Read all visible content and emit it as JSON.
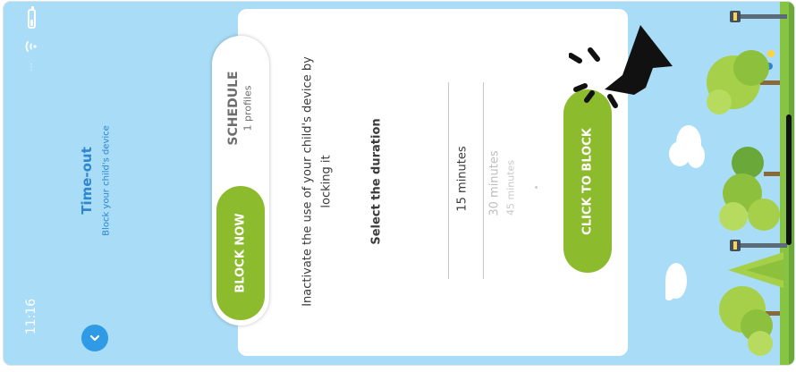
{
  "status_bar": {
    "time": "11:16",
    "icons": [
      "battery-icon",
      "wifi-icon",
      "more-dots-icon"
    ]
  },
  "header": {
    "title": "Time-out",
    "subtitle": "Block your child's device",
    "menu_icon": "chevron-down-icon"
  },
  "tabs": {
    "block_now": "BLOCK NOW",
    "schedule": "SCHEDULE",
    "schedule_sub": "1 profiles",
    "active": "block_now"
  },
  "main": {
    "description_line1": "Inactivate the use of your child's device by",
    "description_line2": "locking it",
    "duration_title": "Select the duration",
    "duration_options": [
      "15 minutes",
      "30 minutes",
      "45 minutes"
    ],
    "selected_duration": "15 minutes",
    "action_button": "CLICK TO BLOCK"
  },
  "decorations": {
    "cursor_icon": "pointer-arrow-icon",
    "scenery": "park-illustration"
  },
  "colors": {
    "background": "#a9dcf7",
    "accent_green": "#8dbb2e",
    "title_blue": "#2f86cf",
    "button_blue": "#2f9ae6",
    "text_dark": "#3b3b3b"
  }
}
